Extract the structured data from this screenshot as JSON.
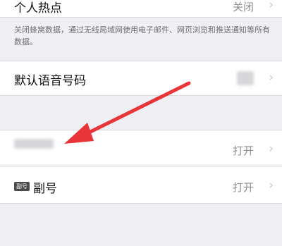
{
  "personal_hotspot": {
    "label": "个人热点",
    "value": "关闭"
  },
  "cellular_footnote": "关闭蜂窝数据，通过无线局域网使用电子邮件、网页浏览和推送通知等所有数据。",
  "default_voice_line": {
    "label": "默认语音号码"
  },
  "primary_line": {
    "value": "打开"
  },
  "secondary_line": {
    "badge": "副号",
    "label": "副号",
    "value": "打开"
  },
  "chevron": "›",
  "colors": {
    "arrow": "#e8353a",
    "background": "#efeff4"
  }
}
